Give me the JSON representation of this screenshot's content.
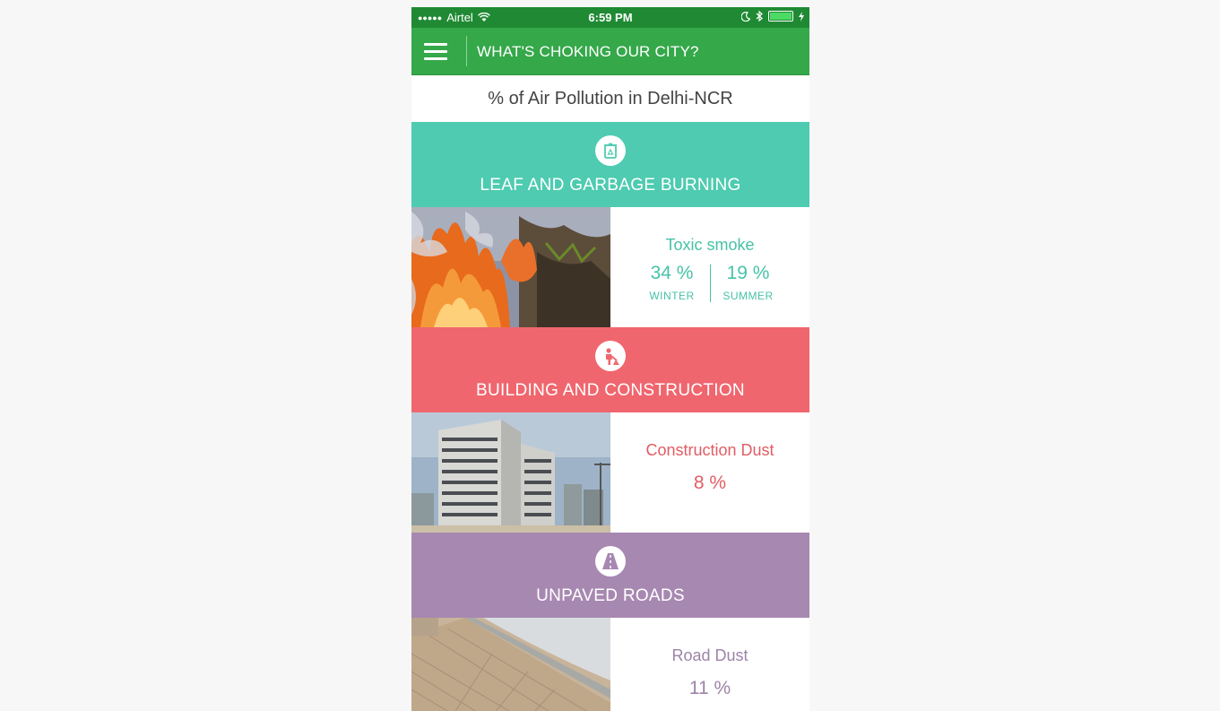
{
  "status_bar": {
    "carrier": "Airtel",
    "time": "6:59 PM"
  },
  "app_bar": {
    "title": "WHAT'S CHOKING OUR CITY?"
  },
  "subtitle": "% of Air Pollution in Delhi-NCR",
  "sections": [
    {
      "title": "LEAF AND GARBAGE BURNING",
      "icon": "garbage-bin-icon",
      "color": "#4ecbb0",
      "heading": "Toxic smoke",
      "winter_value": "34 %",
      "winter_label": "WINTER",
      "summer_value": "19 %",
      "summer_label": "SUMMER"
    },
    {
      "title": "BUILDING AND CONSTRUCTION",
      "icon": "construction-worker-icon",
      "color": "#f0666e",
      "heading": "Construction Dust",
      "value": "8 %"
    },
    {
      "title": "UNPAVED ROADS",
      "icon": "road-icon",
      "color": "#a788b1",
      "heading": "Road Dust",
      "value": "11 %"
    }
  ]
}
